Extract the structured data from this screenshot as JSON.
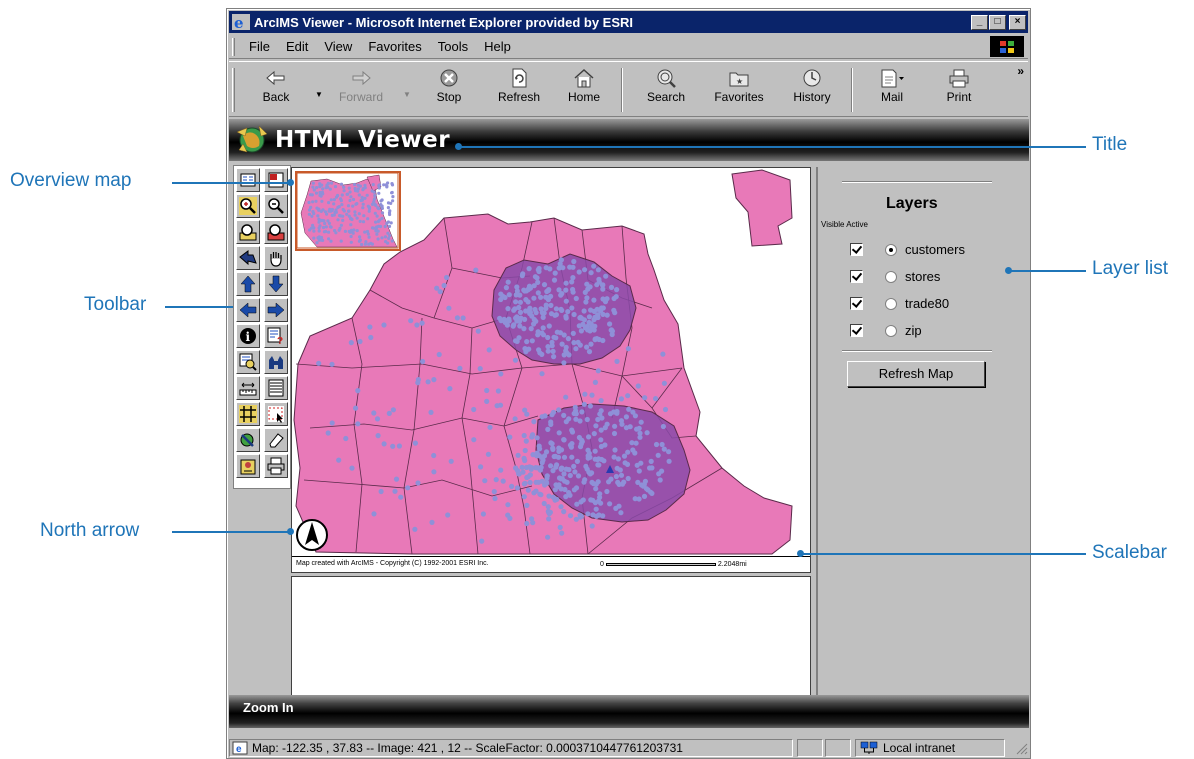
{
  "window": {
    "title": "ArcIMS Viewer - Microsoft Internet Explorer provided by ESRI",
    "minimize": "_",
    "maximize": "□",
    "close": "×"
  },
  "menu": [
    "File",
    "Edit",
    "View",
    "Favorites",
    "Tools",
    "Help"
  ],
  "toolbar": {
    "back": "Back",
    "forward": "Forward",
    "stop": "Stop",
    "refresh": "Refresh",
    "home": "Home",
    "search": "Search",
    "favorites": "Favorites",
    "history": "History",
    "mail": "Mail",
    "print": "Print",
    "more": "»"
  },
  "app": {
    "title": "HTML Viewer"
  },
  "map": {
    "copyright": "Map created with ArcIMS - Copyright (C) 1992-2001 ESRI Inc.",
    "scale_start": "0",
    "scale_end": "2.2048mi",
    "colors": {
      "land": "#e879b8",
      "buffer": "#8a4aa8",
      "points": "#8f90d8",
      "boundary": "#5a2a4a"
    }
  },
  "layers": {
    "heading": "Layers",
    "col_visible": "Visible",
    "col_active": "Active",
    "items": [
      {
        "name": "customers",
        "visible": true,
        "active": true
      },
      {
        "name": "stores",
        "visible": true,
        "active": false
      },
      {
        "name": "trade80",
        "visible": true,
        "active": false
      },
      {
        "name": "zip",
        "visible": true,
        "active": false
      }
    ],
    "refresh_button": "Refresh Map"
  },
  "status_message": "Zoom In",
  "ie_status": {
    "text": "Map: -122.35 , 37.83 -- Image: 421 , 12 -- ScaleFactor: 0.0003710447761203731",
    "zone": "Local intranet"
  },
  "callouts": {
    "overview_map": "Overview map",
    "toolbar": "Toolbar",
    "north_arrow": "North arrow",
    "title": "Title",
    "layer_list": "Layer list",
    "scalebar": "Scalebar"
  }
}
